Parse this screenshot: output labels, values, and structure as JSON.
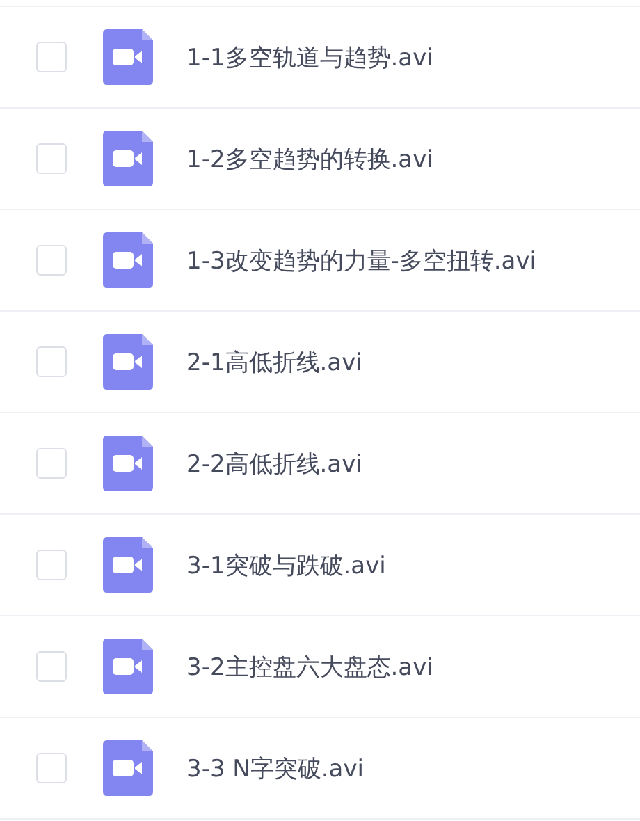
{
  "files": [
    {
      "name": "1-1多空轨道与趋势.avi",
      "checked": false
    },
    {
      "name": "1-2多空趋势的转换.avi",
      "checked": false
    },
    {
      "name": "1-3改变趋势的力量-多空扭转.avi",
      "checked": false
    },
    {
      "name": "2-1高低折线.avi",
      "checked": false
    },
    {
      "name": "2-2高低折线.avi",
      "checked": false
    },
    {
      "name": "3-1突破与跌破.avi",
      "checked": false
    },
    {
      "name": "3-2主控盘六大盘态.avi",
      "checked": false
    },
    {
      "name": "3-3 N字突破.avi",
      "checked": false
    }
  ]
}
